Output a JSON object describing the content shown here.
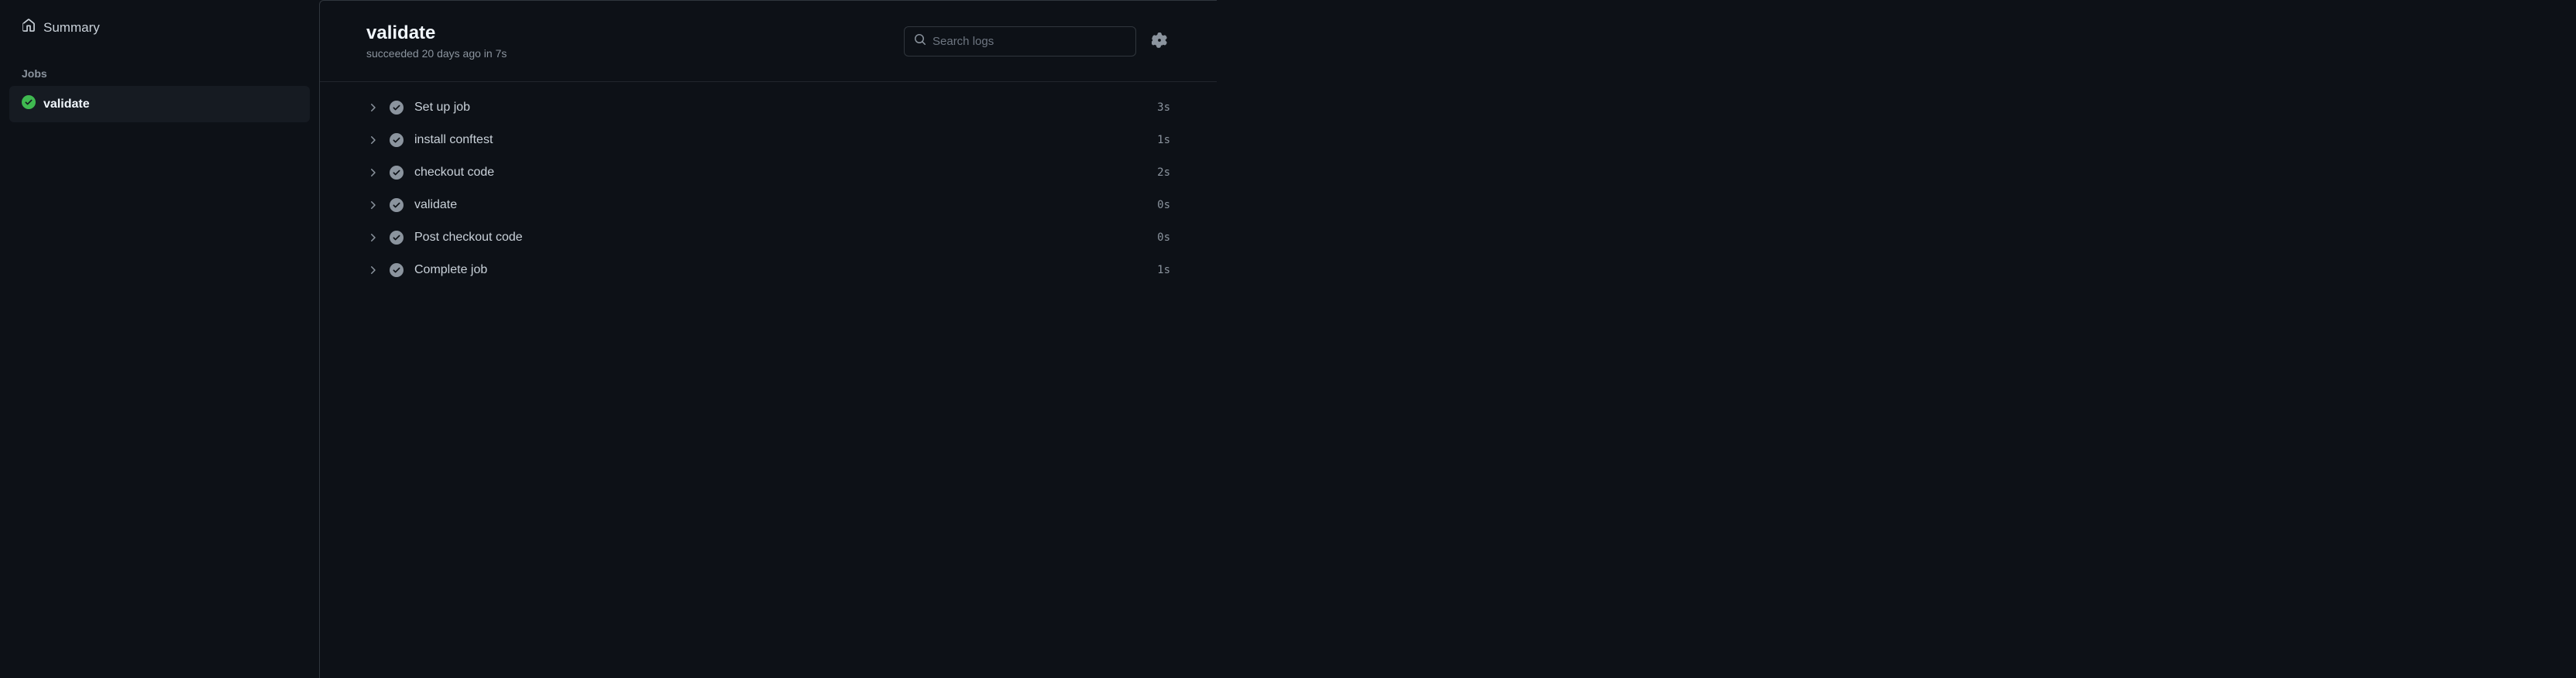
{
  "sidebar": {
    "summary_label": "Summary",
    "jobs_header": "Jobs",
    "jobs": [
      {
        "label": "validate"
      }
    ]
  },
  "header": {
    "title": "validate",
    "subtitle": "succeeded 20 days ago in 7s",
    "search_placeholder": "Search logs"
  },
  "steps": [
    {
      "name": "Set up job",
      "duration": "3s"
    },
    {
      "name": "install conftest",
      "duration": "1s"
    },
    {
      "name": "checkout code",
      "duration": "2s"
    },
    {
      "name": "validate",
      "duration": "0s"
    },
    {
      "name": "Post checkout code",
      "duration": "0s"
    },
    {
      "name": "Complete job",
      "duration": "1s"
    }
  ]
}
